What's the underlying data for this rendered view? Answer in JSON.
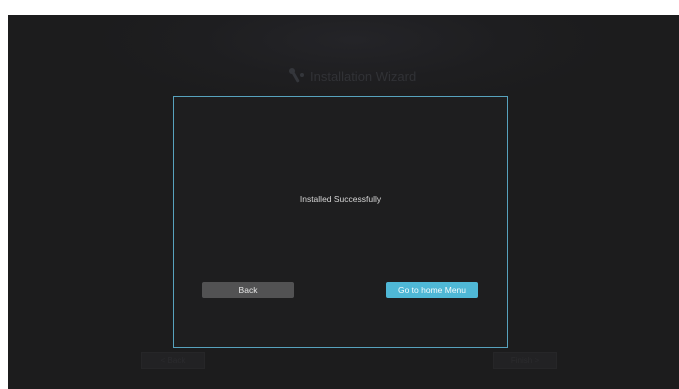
{
  "wizard": {
    "title": "Installation Wizard"
  },
  "background_nav": {
    "prev_label": "< Back",
    "next_label": "Finish >"
  },
  "dialog": {
    "message": "Installed Successfully",
    "back_label": "Back",
    "home_label": "Go to home Menu"
  },
  "colors": {
    "accent": "#4fb8d6",
    "dialog_border": "#57a2bd",
    "background": "#1e1e20"
  }
}
